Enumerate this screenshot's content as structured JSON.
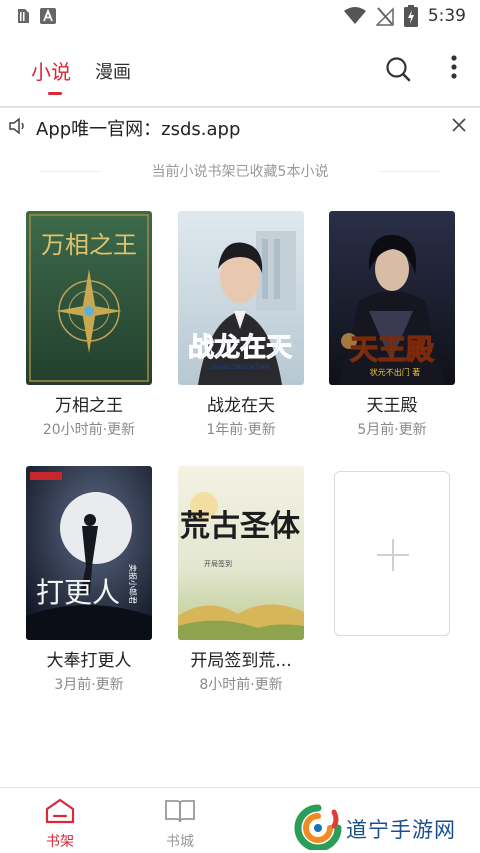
{
  "status_bar": {
    "time": "5:39",
    "icons": [
      "sim-icon",
      "notification-a-icon",
      "wifi-icon",
      "no-signal-icon",
      "battery-icon"
    ]
  },
  "header": {
    "tabs": [
      {
        "label": "小说",
        "active": true
      },
      {
        "label": "漫画",
        "active": false
      }
    ],
    "accent_color": "#d8283a",
    "actions": [
      "search-icon",
      "more-vertical-icon"
    ]
  },
  "notice": {
    "icon": "speaker-icon",
    "text": "App唯一官网：zsds.app",
    "close_icon": "close-icon"
  },
  "shelf": {
    "summary": "当前小说书架已收藏5本小说",
    "books": [
      {
        "title": "万相之王",
        "update": "20小时前·更新",
        "cover_text": "万相之王",
        "cover_color": "#2f5e3f"
      },
      {
        "title": "战龙在天",
        "update": "1年前·更新",
        "cover_text": "战龙在天",
        "cover_subtext": "ZHANLONGZAITIAN",
        "cover_color": "#c9d7df"
      },
      {
        "title": "天王殿",
        "update": "5月前·更新",
        "cover_text": "天王殿",
        "cover_subtext": "状元不出门 著",
        "cover_color": "#1b1d2a"
      },
      {
        "title": "大奉打更人",
        "update": "3月前·更新",
        "cover_text": "打更人",
        "cover_subtext": "卖报小郎君",
        "cover_color": "#1f2a3d"
      },
      {
        "title": "开局签到荒...",
        "update": "8小时前·更新",
        "cover_text": "荒古圣体",
        "cover_subtext": "开局签到",
        "cover_color": "#e8e3c8"
      }
    ],
    "add_icon": "plus-icon"
  },
  "bottom_nav": {
    "items": [
      {
        "label": "书架",
        "icon": "bookshelf-icon",
        "active": true
      },
      {
        "label": "书城",
        "icon": "open-book-icon",
        "active": false
      }
    ]
  },
  "watermark": {
    "text": "道宁手游网"
  }
}
